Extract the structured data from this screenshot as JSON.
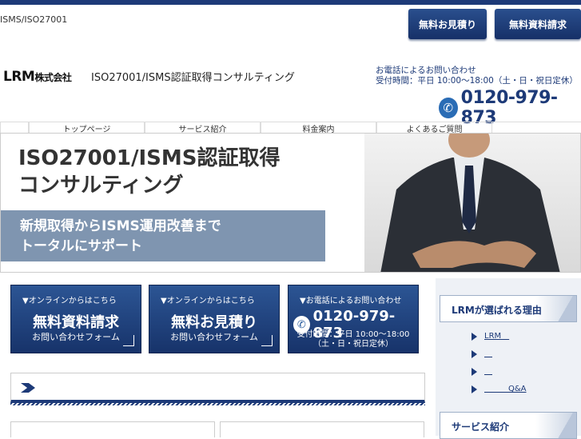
{
  "header": {
    "tagline": "ISMS/ISO27001",
    "btn_estimate": "無料お見積り",
    "btn_docs": "無料資料請求",
    "logo_main": "LRM",
    "logo_sub": "株式会社",
    "site_title": "ISO27001/ISMS認証取得コンサルティング",
    "contact_line1": "お電話によるお問い合わせ",
    "contact_line2": "受付時間：平日 10:00〜18:00（土・日・祝日定休）",
    "phone": "0120-979-873"
  },
  "nav": {
    "items": [
      "トップページ",
      "サービス紹介",
      "料金案内",
      "よくあるご質問"
    ]
  },
  "hero": {
    "title_line1": "ISO27001/ISMS認証取得",
    "title_line2": "コンサルティング",
    "band_line1": "新規取得からISMS運用改善まで",
    "band_line2": "トータルにサポート"
  },
  "cta": {
    "online_pre": "▼オンラインからはこちら",
    "docs_big": "無料資料請求",
    "estimate_big": "無料お見積り",
    "form_sub": "お問い合わせフォーム",
    "phone_pre": "▼お電話によるお問い合わせ",
    "phone": "0120-979-873",
    "hours_line1": "受付時間：平日 10:00〜18:00",
    "hours_line2": "（土・日・祝日定休）"
  },
  "sidebar": {
    "head1": "LRMが選ばれる理由",
    "items": [
      "LRM　",
      "　",
      "　",
      "　　　Q&A"
    ],
    "head2": "サービス紹介"
  },
  "colors": {
    "brand": "#1d3a78",
    "band": "#7f95b0"
  }
}
